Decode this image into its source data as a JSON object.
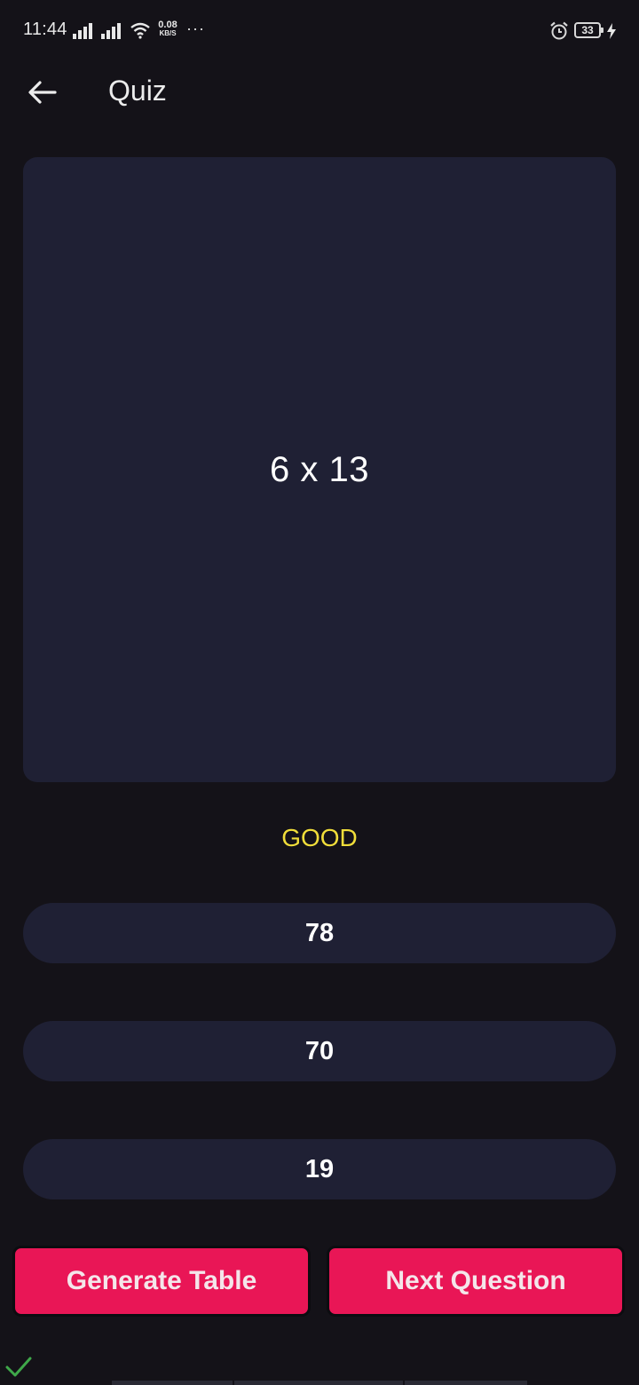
{
  "status_bar": {
    "time": "11:44",
    "net_speed_value": "0.08",
    "net_speed_unit": "KB/S",
    "more": "···",
    "battery_level": "33",
    "icons": [
      "signal-icon",
      "signal-icon",
      "wifi-icon",
      "alarm-icon",
      "battery-icon",
      "charging-icon"
    ]
  },
  "app_bar": {
    "title": "Quiz",
    "back_icon": "arrow-left-icon"
  },
  "quiz": {
    "question": "6 x 13",
    "result": "GOOD",
    "answers": [
      "78",
      "70",
      "19"
    ]
  },
  "actions": {
    "generate_label": "Generate Table",
    "next_label": "Next Question"
  },
  "colors": {
    "background": "#141218",
    "card": "#1f2034",
    "accent": "#e91656",
    "result": "#f1de3a",
    "check": "#3fa84a"
  },
  "footer": {
    "check_icon": "check-icon"
  }
}
